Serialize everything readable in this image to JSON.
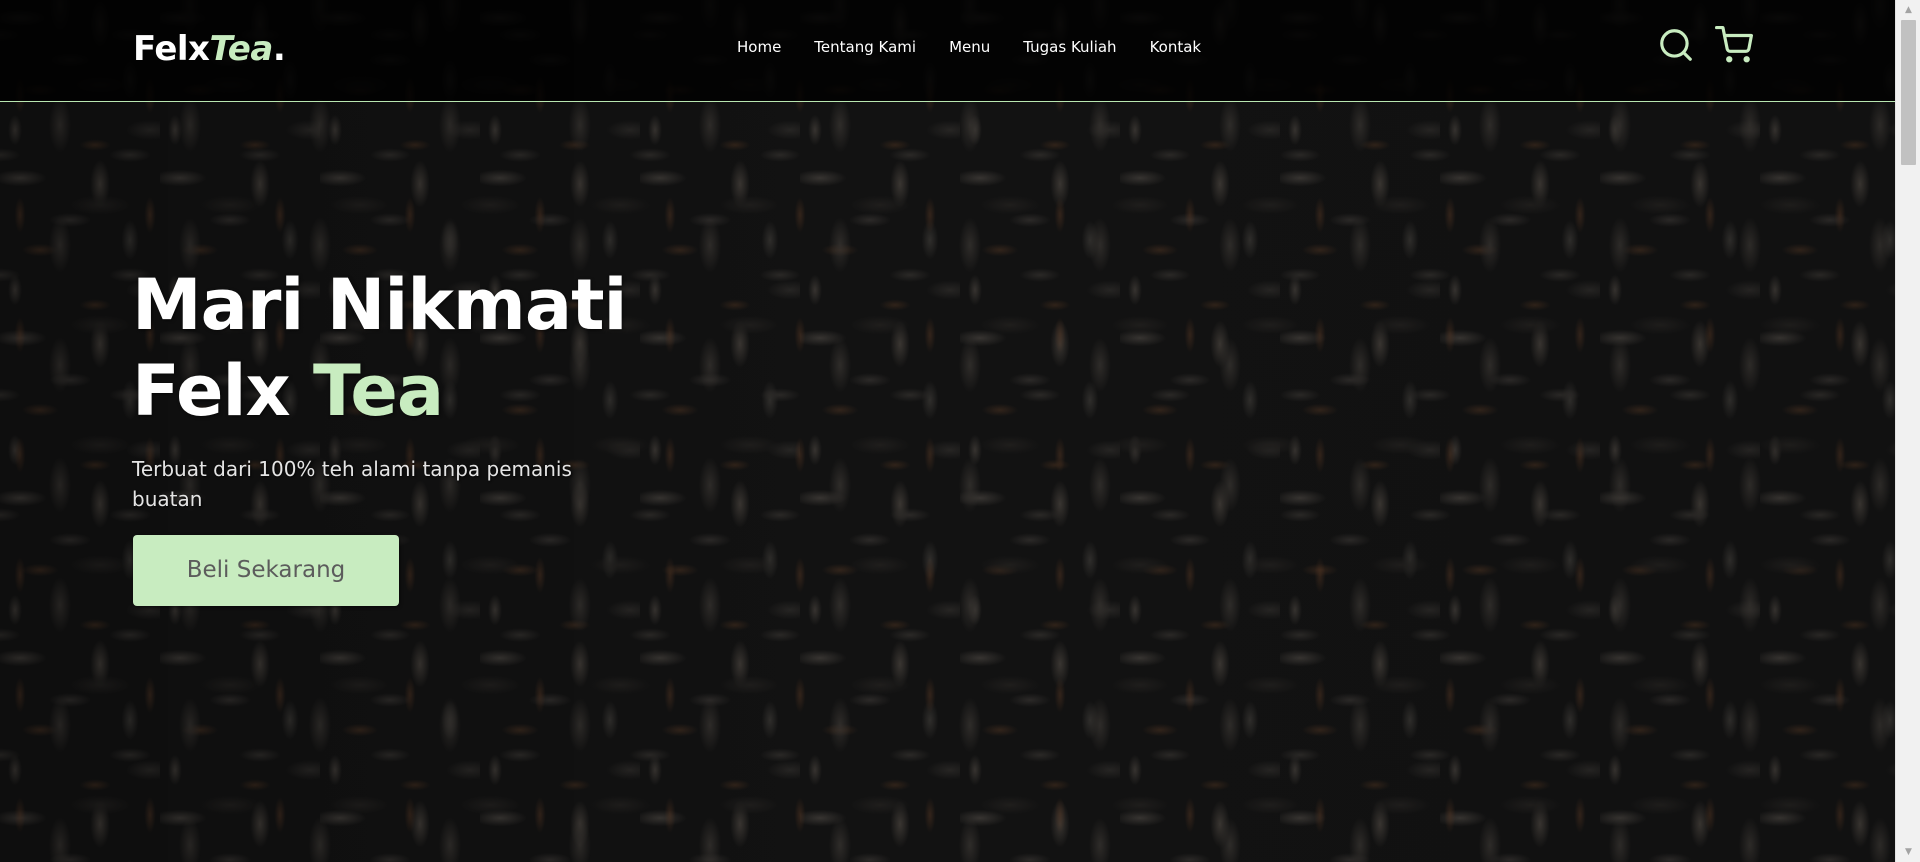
{
  "brand": {
    "name_main": "Felx",
    "name_accent": "Tea",
    "name_dot": ".",
    "accent_color": "#c8ecc0"
  },
  "nav": {
    "items": [
      {
        "label": "Home"
      },
      {
        "label": "Tentang Kami"
      },
      {
        "label": "Menu"
      },
      {
        "label": "Tugas Kuliah"
      },
      {
        "label": "Kontak"
      }
    ],
    "search_icon": "search-icon",
    "cart_icon": "shopping-cart-icon"
  },
  "hero": {
    "title_line1": "Mari Nikmati",
    "title_line2_main": "Felx ",
    "title_line2_accent": "Tea",
    "subtitle": "Terbuat dari 100% teh alami tanpa pemanis buatan",
    "cta_label": "Beli Sekarang"
  }
}
